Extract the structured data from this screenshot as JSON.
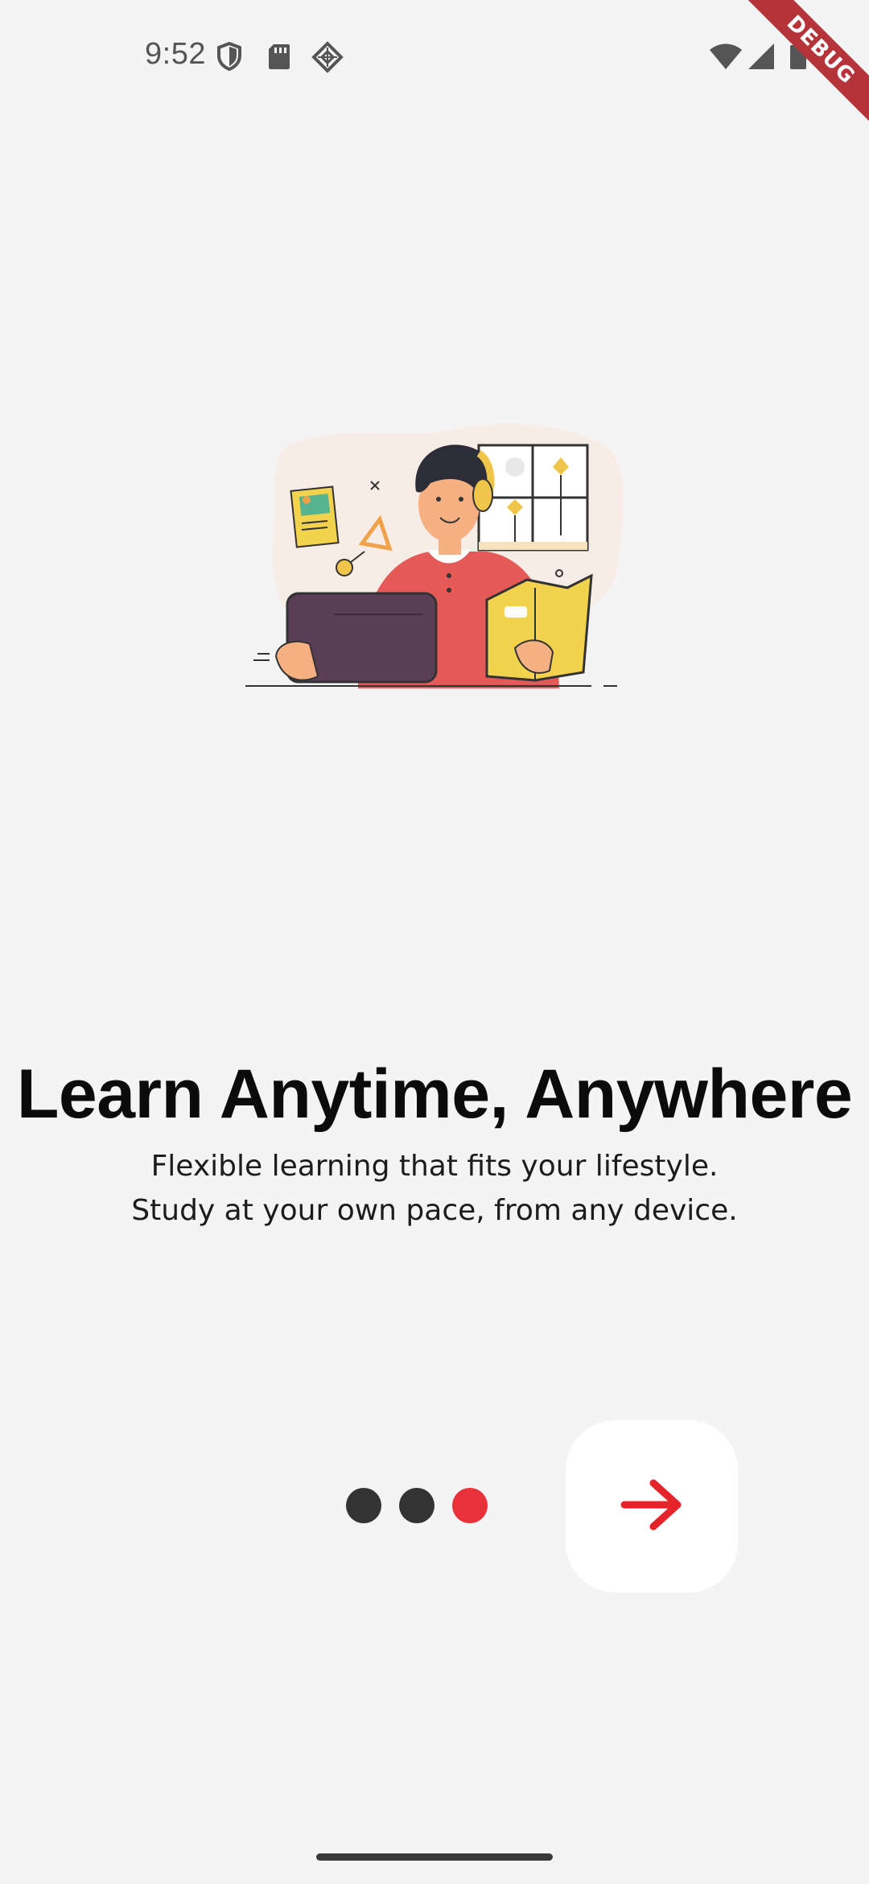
{
  "status_bar": {
    "time": "9:52",
    "icons_left": [
      "shield-icon",
      "sd-card-icon",
      "app-notification-icon"
    ],
    "icons_right": [
      "wifi-icon",
      "cellular-signal-icon",
      "battery-icon"
    ]
  },
  "debug_banner": {
    "label": "DEBUG",
    "color": "#b5343a"
  },
  "onboarding": {
    "illustration": "person-studying-with-tablet-and-book-illustration",
    "title": "Learn Anytime, Anywhere",
    "subtitle_line1": "Flexible learning that fits your lifestyle.",
    "subtitle_line2": "Study at your own pace, from any device.",
    "pages_total": 3,
    "active_page": 3,
    "next_button_icon": "arrow-right-icon"
  },
  "colors": {
    "background": "#f4f4f4",
    "accent": "#e8323a",
    "dot_inactive": "#333333",
    "dot_active": "#e8323a",
    "title": "#0b0b0b"
  }
}
